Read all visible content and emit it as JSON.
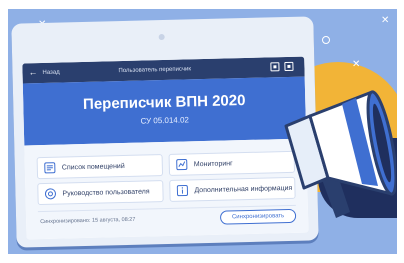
{
  "app": {
    "title": "Переписчик ВПН 2020",
    "version": "СУ 05.014.02"
  },
  "topbar": {
    "back_label": "Назад",
    "screen_title": "Пользователь переписчик"
  },
  "cards": [
    {
      "label": "Список помещений",
      "icon": "list-icon"
    },
    {
      "label": "Мониторинг",
      "icon": "monitoring-icon"
    },
    {
      "label": "Руководство пользователя",
      "icon": "guide-icon"
    },
    {
      "label": "Дополнительная информация",
      "icon": "info-icon"
    }
  ],
  "footer": {
    "sync_status": "Синхронизировано: 15 августа, 08:27",
    "sync_button": "Синхронизировать"
  },
  "colors": {
    "background": "#8fb0e6",
    "accent": "#3f6fd1",
    "topbar": "#2a3f6e",
    "orange": "#f2b437"
  }
}
